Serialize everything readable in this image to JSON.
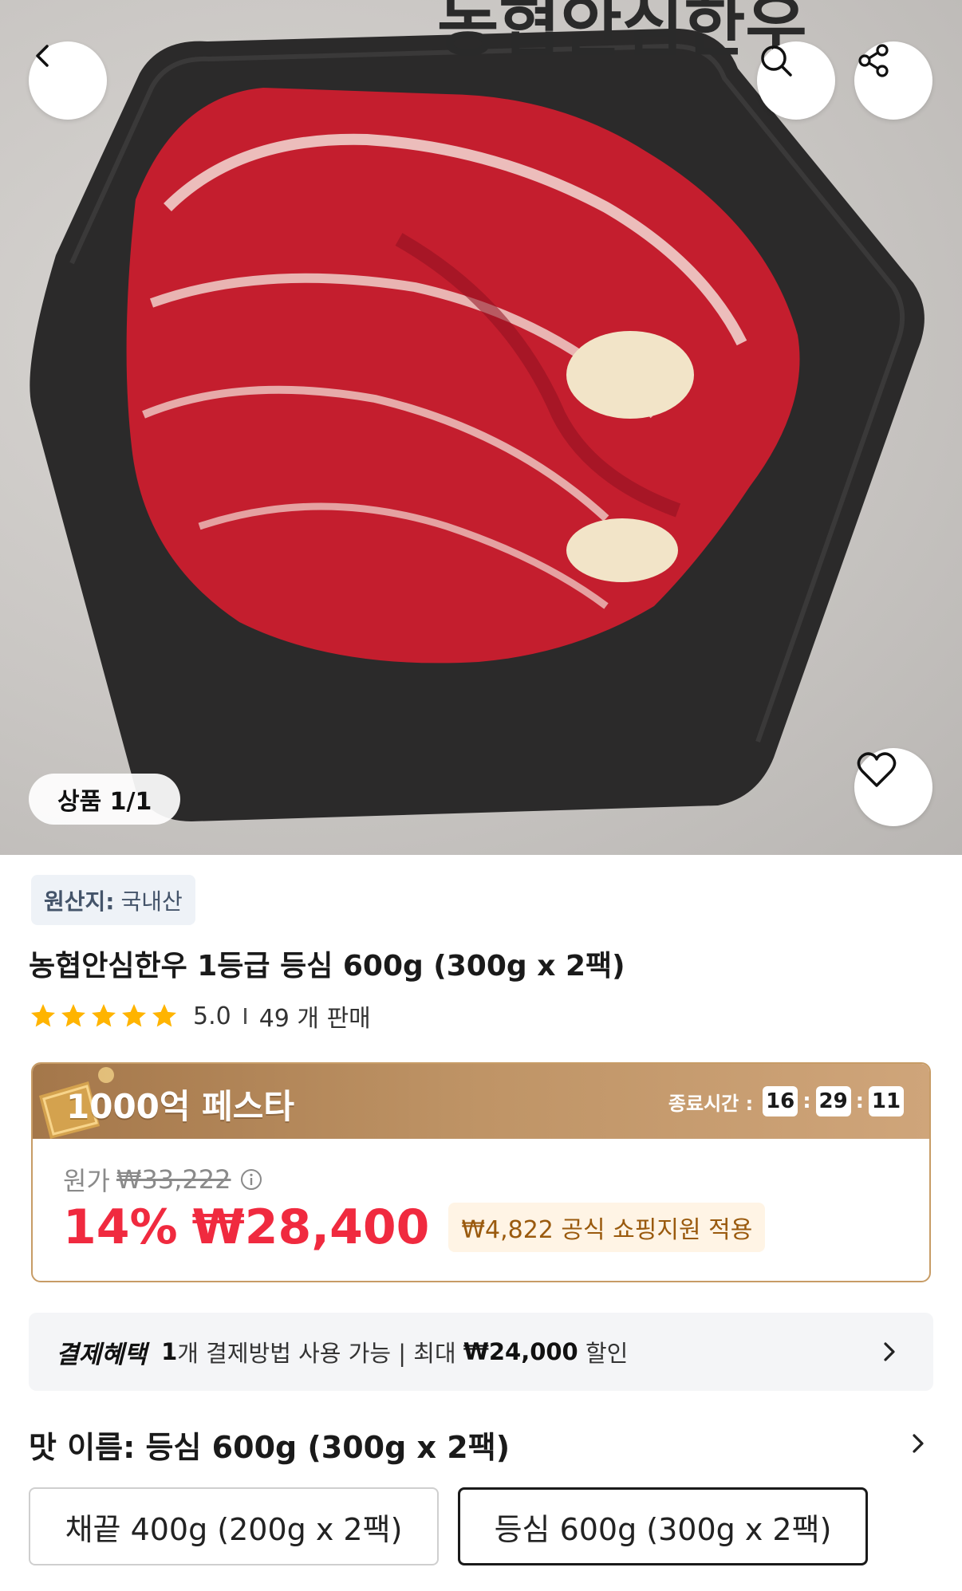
{
  "hero": {
    "brand_text": "농협안심한우",
    "image_counter": "상품 1/1"
  },
  "origin": {
    "label": "원산지:",
    "value": "국내산"
  },
  "product": {
    "title": "농협안심한우 1등급 등심 600g (300g x 2팩)",
    "rating": "5.0",
    "stars": 5,
    "sales": "49 개 판매"
  },
  "festival": {
    "title": "1000억 페스타",
    "timer_label": "종료시간 :",
    "hours": "16",
    "minutes": "29",
    "seconds": "11",
    "original_label": "원가",
    "original_price": "₩33,222",
    "discount": "14%",
    "price": "₩28,400",
    "support_text": "₩4,822 공식 쇼핑지원 적용"
  },
  "benefit": {
    "tag": "결제혜택",
    "count": "1",
    "text_mid": "개 결제방법 사용 가능 | 최대 ",
    "max_amount": "₩24,000",
    "text_end": " 할인"
  },
  "option": {
    "title": "맛 이름: 등심 600g (300g x 2팩)",
    "choices": [
      {
        "label": "채끝 400g (200g x 2팩)",
        "selected": false
      },
      {
        "label": "등심 600g (300g x 2팩)",
        "selected": true
      }
    ]
  },
  "colors": {
    "accent_red": "#f02a3f",
    "fest_gold": "#bf9466",
    "star": "#ffb400"
  }
}
